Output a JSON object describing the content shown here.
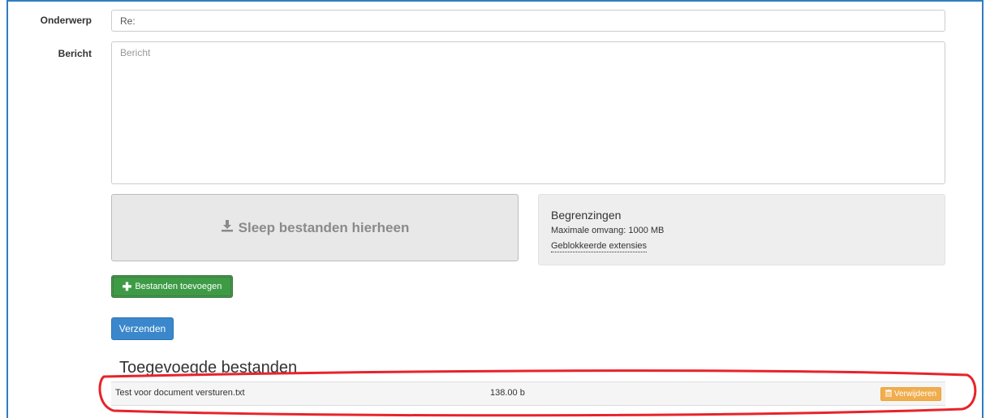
{
  "form": {
    "subject_label": "Onderwerp",
    "subject_value": "Re:",
    "message_label": "Bericht",
    "message_placeholder": "Bericht"
  },
  "dropzone": {
    "text": "Sleep bestanden hierheen",
    "icon": "download-icon"
  },
  "limits": {
    "title": "Begrenzingen",
    "max_size": "Maximale omvang: 1000 MB",
    "blocked_link": "Geblokkeerde extensies"
  },
  "actions": {
    "add_files_label": "Bestanden toevoegen",
    "add_icon": "plus-icon",
    "send_label": "Verzenden"
  },
  "attachments": {
    "title": "Toegevoegde bestanden",
    "files": [
      {
        "name": "Test voor document versturen.txt",
        "size": "138.00 b",
        "delete_label": "Verwijderen",
        "delete_icon": "trash-icon"
      }
    ]
  },
  "colors": {
    "frame_border": "#2f7ec2",
    "add_button": "#3e9b45",
    "send_button": "#3a87cc",
    "delete_button": "#f0ad4e",
    "annotation": "#e8232a"
  }
}
